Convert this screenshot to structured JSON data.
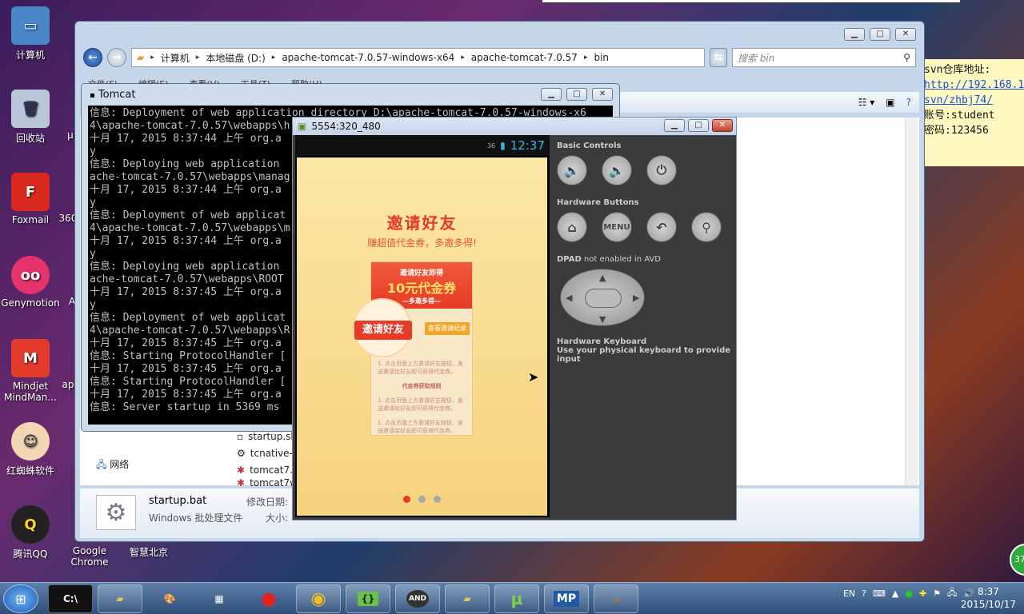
{
  "desktop": {
    "icons": [
      {
        "label": "计算机"
      },
      {
        "label": "回收站"
      },
      {
        "label": "Foxmail"
      },
      {
        "label": "Genymotion"
      },
      {
        "label": "Mindjet MindMan..."
      },
      {
        "label": "红蜘蛛软件"
      },
      {
        "label": "腾讯QQ"
      },
      {
        "label": "Google Chrome"
      },
      {
        "label": "智慧北京"
      }
    ],
    "partial_labels": [
      "360",
      "A",
      "ap",
      "µ"
    ]
  },
  "explorer": {
    "breadcrumbs": [
      "计算机",
      "本地磁盘 (D:)",
      "apache-tomcat-7.0.57-windows-x64",
      "apache-tomcat-7.0.57",
      "bin"
    ],
    "search_placeholder": "搜索 bin",
    "menu": [
      "文件(F)",
      "编辑(E)",
      "查看(V)",
      "工具(T)",
      "帮助(H)"
    ],
    "nav_network": "网络",
    "files": [
      "startup.sh",
      "tcnative-1",
      "tomcat7.e",
      "tomcat7w"
    ],
    "details": {
      "name": "startup.bat",
      "type": "Windows 批处理文件",
      "modified_label": "修改日期:",
      "size_label": "大小:"
    }
  },
  "tomcat": {
    "title": "Tomcat",
    "lines": [
      "信息: Deployment of web application directory D:\\apache-tomcat-7.0.57-windows-x6",
      "4\\apache-tomcat-7.0.57\\webapps\\h",
      "十月 17, 2015 8:37:44 上午 org.a",
      "y",
      "信息: Deploying web application",
      "ache-tomcat-7.0.57\\webapps\\manag",
      "十月 17, 2015 8:37:44 上午 org.a",
      "y",
      "信息: Deployment of web applicat",
      "4\\apache-tomcat-7.0.57\\webapps\\m",
      "十月 17, 2015 8:37:44 上午 org.a",
      "y",
      "信息: Deploying web application",
      "ache-tomcat-7.0.57\\webapps\\ROOT",
      "十月 17, 2015 8:37:45 上午 org.a",
      "y",
      "信息: Deployment of web applicat",
      "4\\apache-tomcat-7.0.57\\webapps\\R",
      "十月 17, 2015 8:37:45 上午 org.a",
      "信息: Starting ProtocolHandler [",
      "十月 17, 2015 8:37:45 上午 org.a",
      "信息: Starting ProtocolHandler [",
      "十月 17, 2015 8:37:45 上午 org.a",
      "信息: Server startup in 5369 ms"
    ]
  },
  "emulator": {
    "title": "5554:320_480",
    "status_time": "12:37",
    "signal": "36",
    "screen": {
      "headline": "邀请好友",
      "subline": "赚超值代金券，多邀多得!",
      "card_top": "邀请好友即得",
      "card_amount": "10元代金券",
      "card_sub": "—多邀多得—",
      "invite_btn": "邀请好友",
      "yellow_btn": "查看邀请纪录",
      "rule_title1": "邀请方法",
      "rule_title2": "代金券获取规则",
      "rule_text": "1. 点击页面上方邀请好友按钮，发送邀请给好友即可获得代金券。"
    },
    "controls": {
      "basic": "Basic Controls",
      "hardware_buttons": "Hardware Buttons",
      "menu_label": "MENU",
      "dpad_strong": "DPAD",
      "dpad_rest": " not enabled in AVD",
      "keyboard_title": "Hardware Keyboard",
      "keyboard_desc": "Use your physical keyboard to provide input"
    }
  },
  "note": {
    "line1": "svn仓库地址:",
    "link1": "http://192.168.1",
    "link2": "svn/zhbj74/",
    "line4": "账号:student",
    "line5": "密码:123456"
  },
  "taskbar": {
    "items": [
      "cmd",
      "explorer",
      "paint",
      "calc",
      "record",
      "chrome",
      "brackets",
      "android",
      "folder",
      "utorrent",
      "MP",
      "java"
    ],
    "lang": "EN",
    "clock_time": "8:37",
    "clock_date": "2015/10/17",
    "badge": "37"
  }
}
